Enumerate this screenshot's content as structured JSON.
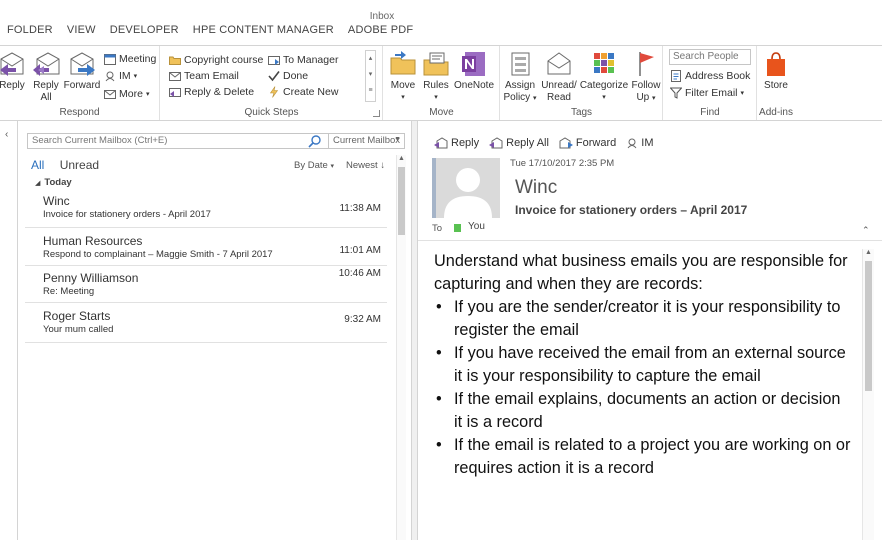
{
  "window": {
    "title": "Inbox"
  },
  "tabs": [
    "FOLDER",
    "VIEW",
    "DEVELOPER",
    "HPE CONTENT MANAGER",
    "ADOBE PDF"
  ],
  "ribbon": {
    "respond": {
      "label": "Respond",
      "reply": "Reply",
      "reply_all_1": "Reply",
      "reply_all_2": "All",
      "forward": "Forward",
      "meeting": "Meeting",
      "im": "IM",
      "more": "More"
    },
    "quick_steps": {
      "label": "Quick Steps",
      "items": [
        "Copyright course",
        "Team Email",
        "Reply & Delete",
        "To Manager",
        "Done",
        "Create New"
      ]
    },
    "move": {
      "label": "Move",
      "move": "Move",
      "rules": "Rules",
      "onenote": "OneNote"
    },
    "tags": {
      "label": "Tags",
      "assign_1": "Assign",
      "assign_2": "Policy",
      "unread_1": "Unread/",
      "unread_2": "Read",
      "categorize": "Categorize",
      "follow_1": "Follow",
      "follow_2": "Up"
    },
    "find": {
      "label": "Find",
      "search_people": "Search People",
      "address_book": "Address Book",
      "filter_email": "Filter Email"
    },
    "addins": {
      "label": "Add-ins",
      "store": "Store"
    }
  },
  "list": {
    "search_placeholder": "Search Current Mailbox (Ctrl+E)",
    "scope": "Current Mailbox",
    "filter_all": "All",
    "filter_unread": "Unread",
    "sort_by": "By Date",
    "sort_order": "Newest",
    "group_today": "Today",
    "items": [
      {
        "sender": "Winc",
        "subject": "Invoice for stationery orders - April 2017",
        "time": "11:38 AM"
      },
      {
        "sender": "Human Resources",
        "subject": "Respond to complainant – Maggie Smith - 7 April 2017",
        "time": "11:01 AM"
      },
      {
        "sender": "Penny Williamson",
        "subject": "Re: Meeting",
        "time": "10:46 AM"
      },
      {
        "sender": "Roger Starts",
        "subject": "Your mum called",
        "time": "9:32 AM"
      }
    ]
  },
  "reading": {
    "actions": {
      "reply": "Reply",
      "reply_all": "Reply All",
      "forward": "Forward",
      "im": "IM"
    },
    "date": "Tue 17/10/2017 2:35 PM",
    "from": "Winc",
    "subject": "Invoice for stationery orders – April 2017",
    "to_label": "To",
    "to_name": "You",
    "body_intro": "Understand what business emails you are responsible for capturing and when they are records:",
    "bullets": [
      "If you are the sender/creator it is your responsibility to register the email",
      "If you have received the email from an external source it is your responsibility to capture the email",
      "If the email explains, documents an action or decision it is a record",
      "If the email is related to a project you are working on or requires action it is a record"
    ]
  },
  "colors": {
    "accent": "#2a6fbd",
    "presence": "#59c151",
    "onenote": "#7b3fa0",
    "store": "#e8541c",
    "flag": "#e04a3c"
  }
}
